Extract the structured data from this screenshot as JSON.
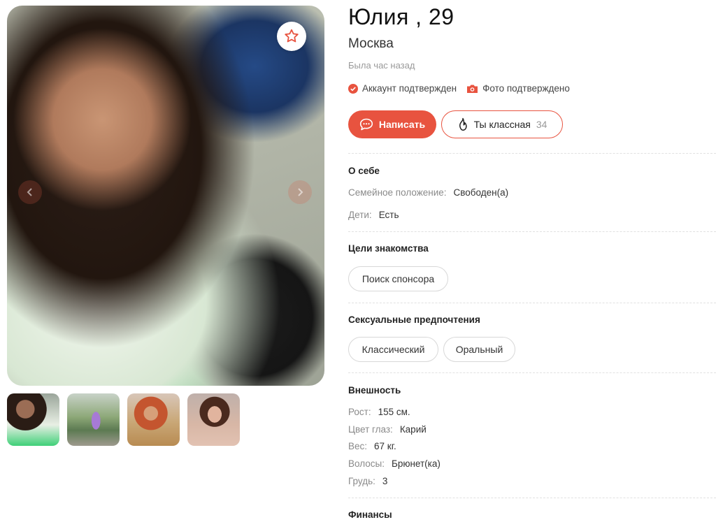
{
  "profile": {
    "name_age": "Юлия , 29",
    "city": "Москва",
    "last_seen": "Была час назад"
  },
  "badges": {
    "account": "Аккаунт подтвержден",
    "photo": "Фото подтверждено"
  },
  "actions": {
    "write_label": "Написать",
    "like_label": "Ты классная",
    "like_count": "34"
  },
  "about": {
    "title": "О себе",
    "rows": [
      {
        "label": "Семейное положение:",
        "value": "Свободен(а)"
      },
      {
        "label": "Дети:",
        "value": "Есть"
      }
    ]
  },
  "goals": {
    "title": "Цели знакомства",
    "chips": [
      "Поиск спонсора"
    ]
  },
  "preferences": {
    "title": "Сексуальные предпочтения",
    "chips": [
      "Классический",
      "Оральный"
    ]
  },
  "appearance": {
    "title": "Внешность",
    "rows": [
      {
        "label": "Рост:",
        "value": "155 см."
      },
      {
        "label": "Цвет глаз:",
        "value": "Карий"
      },
      {
        "label": "Вес:",
        "value": "67 кг."
      },
      {
        "label": "Волосы:",
        "value": "Брюнет(ка)"
      },
      {
        "label": "Грудь:",
        "value": "3"
      }
    ]
  },
  "finances": {
    "title": "Финансы"
  },
  "colors": {
    "accent": "#e8533f",
    "muted_text": "#9a9a9a",
    "divider": "#e1e1e1"
  },
  "icons": {
    "favorite": "star-outline-icon",
    "write": "chat-bubble-icon",
    "like": "flame-icon",
    "account_badge": "check-circle-icon",
    "photo_badge": "camera-icon"
  }
}
